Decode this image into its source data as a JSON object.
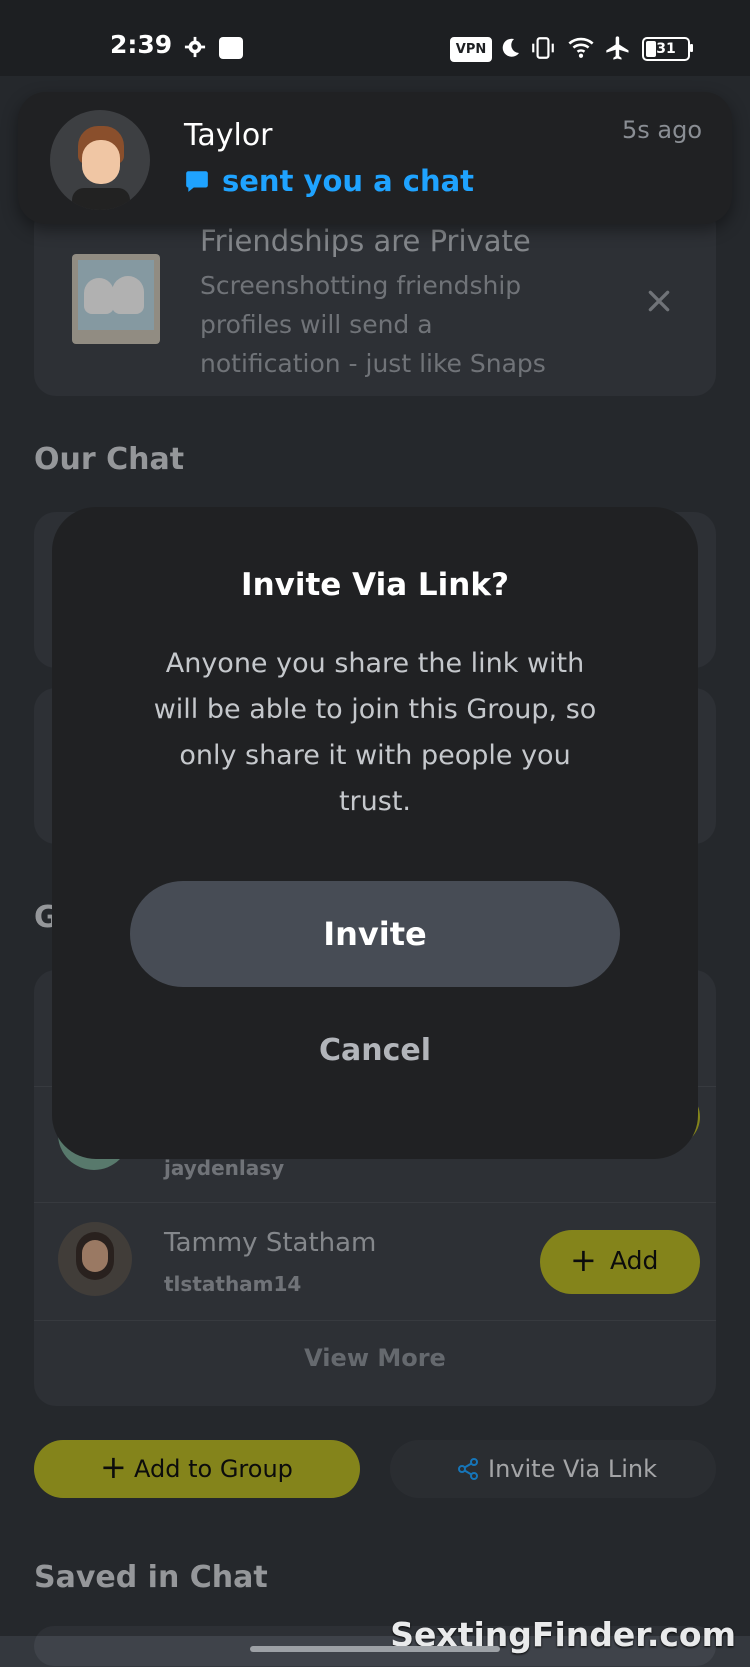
{
  "status_bar": {
    "time": "2:39",
    "vpn_label": "VPN",
    "battery_level": "31",
    "icons": [
      "gear-icon",
      "app-notification-icon",
      "vpn-icon",
      "moon-icon",
      "vibrate-icon",
      "wifi-icon",
      "airplane-icon",
      "battery-icon"
    ]
  },
  "notification": {
    "sender_name": "Taylor",
    "message": "sent you a chat",
    "time": "5s ago",
    "message_color": "#1fa3ff"
  },
  "privacy_card": {
    "title": "Friendships are Private",
    "description_lines": [
      "Screenshotting friendship",
      "profiles will send a",
      "notification - just like Snaps"
    ]
  },
  "sections": {
    "our_chat": "Our Chat",
    "group_partial": "G",
    "saved_in_chat": "Saved in Chat"
  },
  "dialog": {
    "title": "Invite Via Link?",
    "body_lines": [
      "Anyone you share the link with",
      "will be able to join this Group, so",
      "only share it with people you",
      "trust."
    ],
    "invite_label": "Invite",
    "cancel_label": "Cancel"
  },
  "suggestions": [
    {
      "name": "",
      "username": "jaydenlasy",
      "add_label": "Add"
    },
    {
      "name": "Tammy Statham",
      "username": "tlstatham14",
      "add_label": "Add"
    }
  ],
  "view_more_label": "View More",
  "bottom_actions": {
    "add_to_group": "Add to Group",
    "invite_via_link": "Invite Via Link"
  },
  "watermark": "SextingFinder.com",
  "colors": {
    "accent_yellow": "#b8b826",
    "link_blue": "#1fa3ff",
    "dialog_bg": "#202123"
  }
}
